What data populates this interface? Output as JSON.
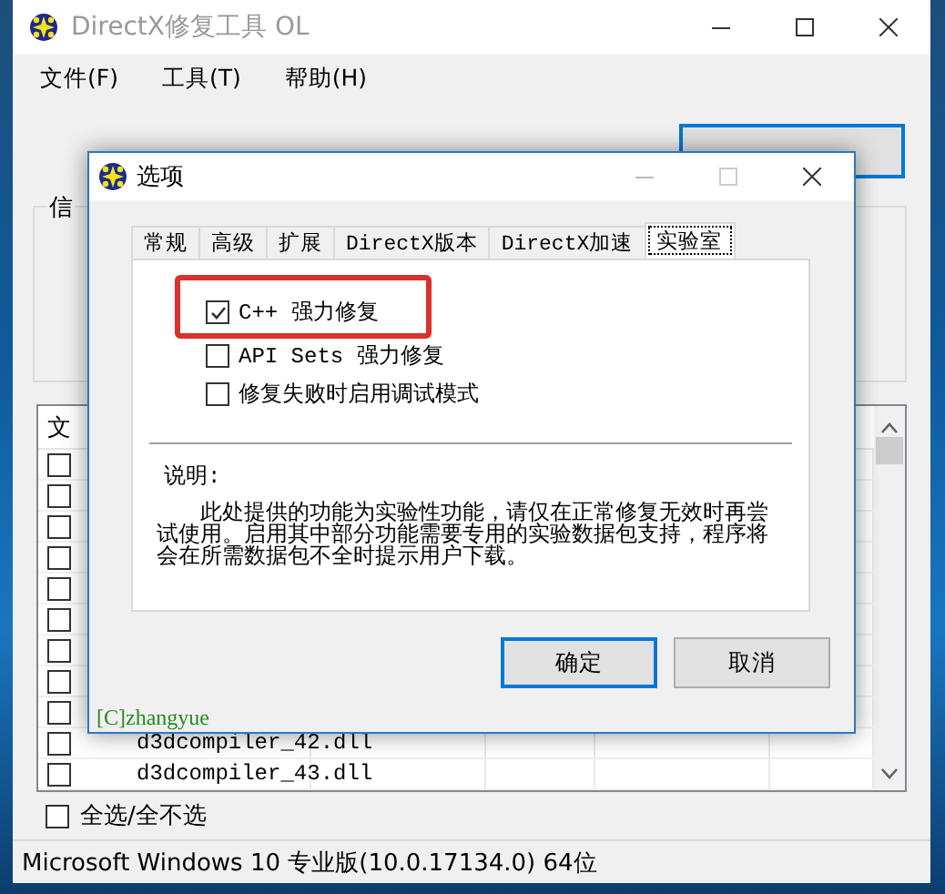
{
  "main_window": {
    "title": "DirectX修复工具 OL",
    "menu": [
      "文件(F)",
      "工具(T)",
      "帮助(H)"
    ],
    "action_button": {
      "kind": "button"
    },
    "info_group": {
      "label": "信"
    },
    "file_list": {
      "columns": [
        "文"
      ],
      "rows": [
        {
          "checked": false
        },
        {
          "checked": false
        },
        {
          "checked": false
        },
        {
          "checked": false
        },
        {
          "checked": false
        },
        {
          "checked": false
        },
        {
          "checked": false
        },
        {
          "checked": false
        },
        {
          "checked": false
        },
        {
          "checked": false,
          "name": "d3dcompiler_42.dll"
        },
        {
          "checked": false,
          "name": "d3dcompiler_43.dll"
        }
      ]
    },
    "select_all": {
      "label": "全选/全不选",
      "checked": false
    },
    "status_bar": "Microsoft Windows 10 专业版(10.0.17134.0) 64位"
  },
  "dialog": {
    "title": "选项",
    "tabs": [
      {
        "label": "常规",
        "selected": false
      },
      {
        "label": "高级",
        "selected": false
      },
      {
        "label": "扩展",
        "selected": false
      },
      {
        "label": "DirectX版本",
        "selected": false
      },
      {
        "label": "DirectX加速",
        "selected": false
      },
      {
        "label": "实验室",
        "selected": true
      }
    ],
    "options": [
      {
        "label": "C++ 强力修复",
        "checked": true,
        "highlighted": true
      },
      {
        "label": "API Sets 强力修复",
        "checked": false,
        "highlighted": false
      },
      {
        "label": "修复失败时启用调试模式",
        "checked": false,
        "highlighted": false
      }
    ],
    "note": {
      "heading": "说明:",
      "text": "此处提供的功能为实验性功能，请仅在正常修复无效时再尝试使用。启用其中部分功能需要专用的实验数据包支持，程序将会在所需数据包不全时提示用户下载。"
    },
    "buttons": [
      {
        "label": "确定",
        "default": true
      },
      {
        "label": "取消",
        "default": false
      }
    ],
    "footer": "[C]zhangyue"
  }
}
